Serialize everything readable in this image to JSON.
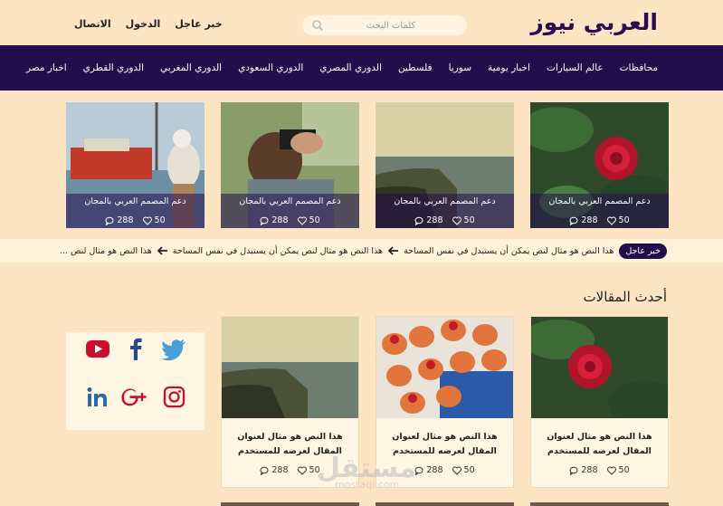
{
  "header": {
    "logo": "العربي نيوز",
    "search_placeholder": "كلمات البحث",
    "links": [
      "خبر عاجل",
      "الدخول",
      "الاتصال"
    ]
  },
  "nav": [
    "محافظات",
    "عالم السيارات",
    "اخبار يومية",
    "سوريا",
    "فلسطين",
    "الدوري المصري",
    "الدوري السعودي",
    "الدوري المغربي",
    "الدوري القطري",
    "اخبار مصر"
  ],
  "featured": [
    {
      "caption": "دعم المصمم العربي بالمجان",
      "likes": "50",
      "comments": "288",
      "image": "red-rose"
    },
    {
      "caption": "دعم المصمم العربي بالمجان",
      "likes": "50",
      "comments": "288",
      "image": "coast-cliff"
    },
    {
      "caption": "دعم المصمم العربي بالمجان",
      "likes": "50",
      "comments": "288",
      "image": "photographer"
    },
    {
      "caption": "دعم المصمم العربي بالمجان",
      "likes": "50",
      "comments": "288",
      "image": "seagull-harbor"
    }
  ],
  "ticker": {
    "badge": "خبر عاجل",
    "items": [
      "هذا النص هو مثال لنص يمكن أن يستبدل في نفس المساحة",
      "هذا النص هو مثال لنص يمكن أن يستبدل في نفس المساحة",
      "هذا النص هو مثال لنص ..."
    ]
  },
  "articles_title": "أحدث المقالات",
  "articles": [
    {
      "title": "هذا النص هو مثال لعنوان المقال لعرضه للمستخدم",
      "likes": "50",
      "comments": "288",
      "image": "red-rose"
    },
    {
      "title": "هذا النص هو مثال لعنوان المقال لعرضه للمستخدم",
      "likes": "50",
      "comments": "288",
      "image": "desserts"
    },
    {
      "title": "هذا النص هو مثال لعنوان المقال لعرضه للمستخدم",
      "likes": "50",
      "comments": "288",
      "image": "coast-cliff"
    }
  ],
  "social": [
    "twitter-icon",
    "facebook-icon",
    "youtube-icon",
    "instagram-icon",
    "google-plus-icon",
    "linkedin-icon"
  ],
  "watermark": {
    "arabic": "مستقل",
    "latin": "mostaql.com"
  },
  "colors": {
    "primary": "#230d4d",
    "background": "#fde5c3"
  }
}
